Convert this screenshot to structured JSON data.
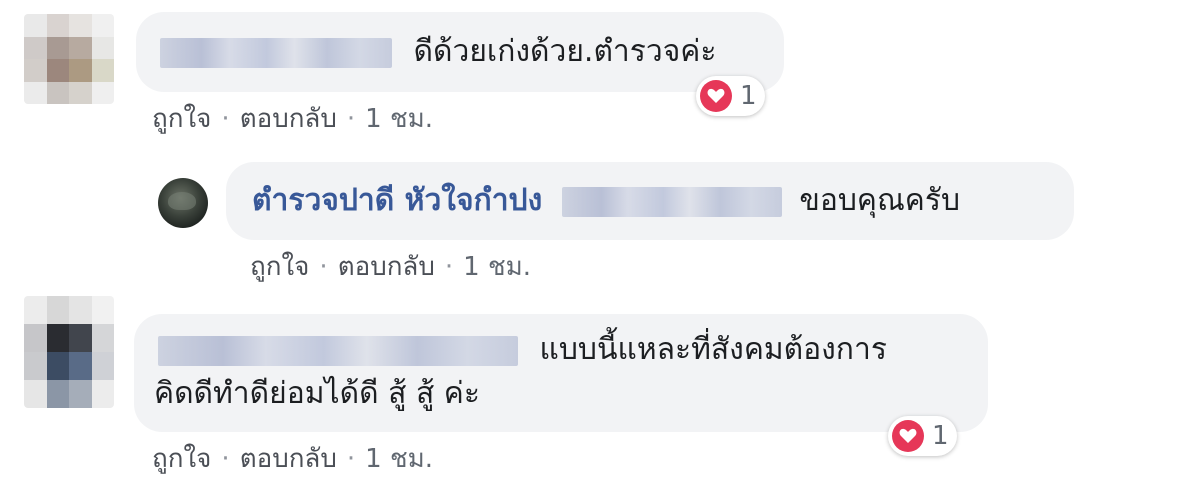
{
  "comments": [
    {
      "text": "ดีด้วยเก่งด้วย.ตำรวจค่ะ",
      "actions": {
        "like": "ถูกใจ",
        "reply": "ตอบกลับ",
        "time": "1 ชม."
      },
      "reaction": {
        "icon": "heart-icon",
        "count": "1"
      }
    },
    {
      "author": "ตำรวจปาดี หัวใจกำปง",
      "text": "ขอบคุณครับ",
      "actions": {
        "like": "ถูกใจ",
        "reply": "ตอบกลับ",
        "time": "1 ชม."
      }
    },
    {
      "text_line1": "แบบนี้แหละที่สังคมต้องการ",
      "text_line2": "คิดดีทำดีย่อมได้ดี สู้ สู้ ค่ะ",
      "actions": {
        "like": "ถูกใจ",
        "reply": "ตอบกลับ",
        "time": "1 ชม."
      },
      "reaction": {
        "icon": "heart-icon",
        "count": "1"
      }
    }
  ],
  "colors": {
    "bubble": "#f2f3f5",
    "author": "#385898",
    "heart": "#e63758",
    "meta": "#606770"
  }
}
